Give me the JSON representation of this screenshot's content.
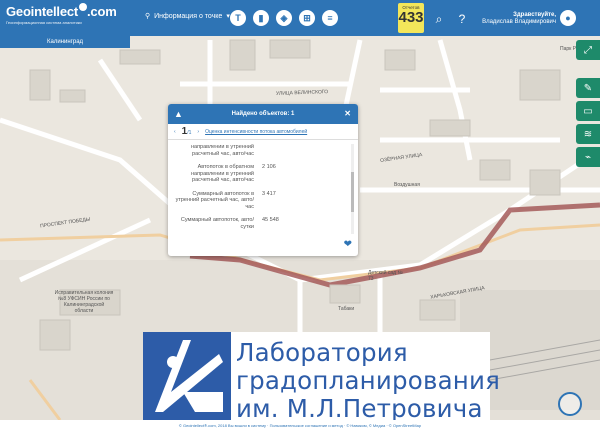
{
  "header": {
    "logo": "Geointellect",
    "logo_tld": ".com",
    "tagline": "Геоинформационная система аналитики",
    "info_dropdown": "Информация о точке",
    "reports_label": "Отчетов",
    "reports_count": "433",
    "greeting": "Здравствуйте,",
    "user_name": "Владислав Владимирович"
  },
  "region": "Калининград",
  "popup": {
    "title": "Найдено объектов: 1",
    "page": "1",
    "page_total": "/1",
    "layer_name": "Оценка интенсивности потока автомобилей",
    "rows": [
      {
        "key": "направлении в утренний расчетный час, авто/час",
        "value": ""
      },
      {
        "key": "Автопоток в обратном направлении в утренний расчетный час, авто/час",
        "value": "2 106"
      },
      {
        "key": "Суммарный автопоток в утренний расчетный час, авто/час",
        "value": "3 417"
      },
      {
        "key": "Суммарный автопоток, авто/сутки",
        "value": "45 548"
      }
    ]
  },
  "banner": {
    "line1": "Лаборатория",
    "line2": "градопланирования",
    "line3": "им. М.Л.Петровича",
    "brand_color": "#2d5ca8"
  },
  "footer": "© Geointellect®.com, 2018 Вы вошли в систему · Пользовательское соглашение и метод · © Навиком, © Медиа · © OpenStreetMap",
  "map_labels": {
    "street_velinskogo": "УЛИЦА ВЕЛИНСКОГО",
    "street_pobedy": "ПРОСПЕКТ ПОБЕДЫ",
    "street_kharkovskaya": "ХАРЬКОВСКАЯ УЛИЦА",
    "street_ozernaya": "ОЗЁРНАЯ УЛИЦА",
    "kindergarten": "Детский сад № 73",
    "prison": "Исправительная колония №8 УФСИН России по Калининградской области",
    "park": "Парк Ра",
    "vozdushny": "Воздушная",
    "tabaki": "Табаки"
  },
  "colors": {
    "accent": "#2e74b5",
    "route": "#a45a5a",
    "counter_bg": "#f3e65a",
    "side_green": "#1e8a6a"
  }
}
